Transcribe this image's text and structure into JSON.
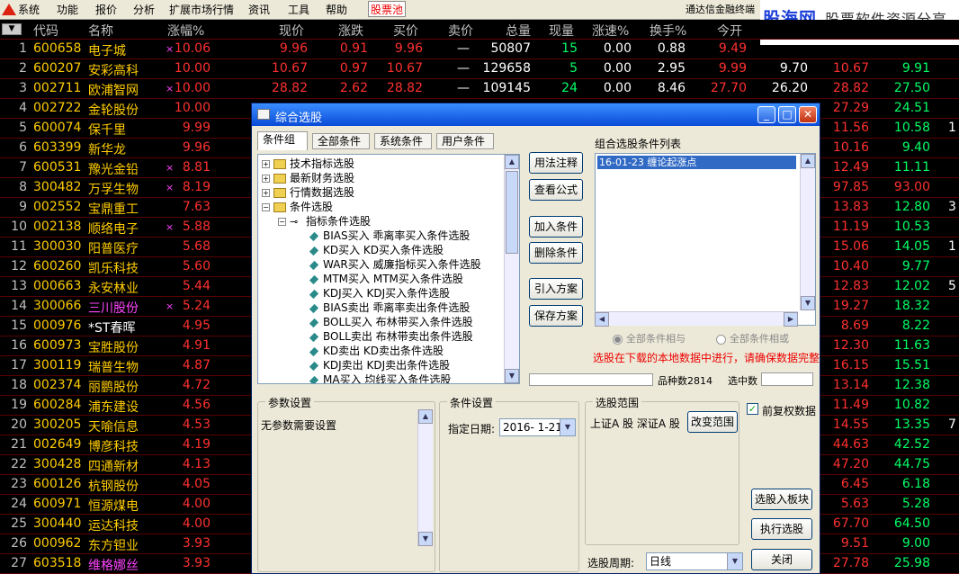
{
  "menu": [
    "系统",
    "功能",
    "报价",
    "分析",
    "扩展市场行情",
    "资讯",
    "工具",
    "帮助",
    "股票池"
  ],
  "broker": "通达信金融终端",
  "brand": {
    "name": "股海网",
    "slogan": "股票软件资源分享",
    "url": "Www.Guhai.com.cn"
  },
  "columns": [
    "代码",
    "名称",
    "涨幅%",
    "现价",
    "涨跌",
    "买价",
    "卖价",
    "总量",
    "现量",
    "涨速%",
    "换手%",
    "今开"
  ],
  "rows": [
    {
      "n": "1",
      "code": "600658",
      "name": "电子城",
      "mark": "×",
      "chg": "10.06",
      "price": "9.96",
      "rise": "0.91",
      "bid": "9.96",
      "ask": "—",
      "vol": "50807",
      "cur": "15",
      "spd": "0.00",
      "turn": "0.88",
      "open": "9.49",
      "prev": "",
      "high": "",
      "low": "",
      "ex": ""
    },
    {
      "n": "2",
      "code": "600207",
      "name": "安彩高科",
      "mark": "",
      "chg": "10.00",
      "price": "10.67",
      "rise": "0.97",
      "bid": "10.67",
      "ask": "—",
      "vol": "129658",
      "cur": "5",
      "spd": "0.00",
      "turn": "2.95",
      "open": "9.99",
      "prev": "9.70",
      "high": "10.67",
      "low": "9.91",
      "ex": ""
    },
    {
      "n": "3",
      "code": "002711",
      "name": "欧浦智网",
      "mark": "×",
      "chg": "10.00",
      "price": "28.82",
      "rise": "2.62",
      "bid": "28.82",
      "ask": "—",
      "vol": "109145",
      "cur": "24",
      "spd": "0.00",
      "turn": "8.46",
      "open": "27.70",
      "prev": "26.20",
      "high": "28.82",
      "low": "27.50",
      "ex": ""
    },
    {
      "n": "4",
      "code": "002722",
      "name": "金轮股份",
      "mark": "",
      "chg": "10.00",
      "price": "",
      "rise": "",
      "bid": "",
      "ask": "",
      "vol": "",
      "cur": "",
      "spd": "",
      "turn": "",
      "open": "",
      "prev": "",
      "high": "27.29",
      "low": "24.51",
      "ex": ""
    },
    {
      "n": "5",
      "code": "600074",
      "name": "保千里",
      "mark": "",
      "chg": "9.99",
      "price": "",
      "rise": "",
      "bid": "",
      "ask": "",
      "vol": "",
      "cur": "",
      "spd": "",
      "turn": "",
      "open": "",
      "prev": "",
      "high": "11.56",
      "low": "10.58",
      "ex": "1"
    },
    {
      "n": "6",
      "code": "603399",
      "name": "新华龙",
      "mark": "",
      "chg": "9.96",
      "price": "",
      "rise": "",
      "bid": "",
      "ask": "",
      "vol": "",
      "cur": "",
      "spd": "",
      "turn": "",
      "open": "",
      "prev": "",
      "high": "10.16",
      "low": "9.40",
      "ex": ""
    },
    {
      "n": "7",
      "code": "600531",
      "name": "豫光金铅",
      "mark": "×",
      "chg": "8.81",
      "price": "",
      "rise": "",
      "bid": "",
      "ask": "",
      "vol": "",
      "cur": "",
      "spd": "",
      "turn": "",
      "open": "",
      "prev": "",
      "high": "12.49",
      "low": "11.11",
      "ex": ""
    },
    {
      "n": "8",
      "code": "300482",
      "name": "万孚生物",
      "mark": "×",
      "chg": "8.19",
      "price": "",
      "rise": "",
      "bid": "",
      "ask": "",
      "vol": "",
      "cur": "",
      "spd": "",
      "turn": "",
      "open": "",
      "prev": "",
      "high": "97.85",
      "low": "93.00",
      "lowRed": true,
      "ex": ""
    },
    {
      "n": "9",
      "code": "002552",
      "name": "宝鼎重工",
      "mark": "",
      "chg": "7.63",
      "price": "",
      "rise": "",
      "bid": "",
      "ask": "",
      "vol": "",
      "cur": "",
      "spd": "",
      "turn": "",
      "open": "",
      "prev": "",
      "high": "13.83",
      "low": "12.80",
      "ex": "3"
    },
    {
      "n": "10",
      "code": "002138",
      "name": "顺络电子",
      "mark": "×",
      "chg": "5.88",
      "price": "",
      "rise": "",
      "bid": "",
      "ask": "",
      "vol": "",
      "cur": "",
      "spd": "",
      "turn": "",
      "open": "",
      "prev": "",
      "high": "11.19",
      "low": "10.53",
      "ex": ""
    },
    {
      "n": "11",
      "code": "300030",
      "name": "阳普医疗",
      "mark": "",
      "chg": "5.68",
      "price": "",
      "rise": "",
      "bid": "",
      "ask": "",
      "vol": "",
      "cur": "",
      "spd": "",
      "turn": "",
      "open": "",
      "prev": "",
      "high": "15.06",
      "low": "14.05",
      "ex": "1"
    },
    {
      "n": "12",
      "code": "600260",
      "name": "凯乐科技",
      "mark": "",
      "chg": "5.60",
      "price": "",
      "rise": "",
      "bid": "",
      "ask": "",
      "vol": "",
      "cur": "",
      "spd": "",
      "turn": "",
      "open": "",
      "prev": "",
      "high": "10.40",
      "low": "9.77",
      "ex": ""
    },
    {
      "n": "13",
      "code": "000663",
      "name": "永安林业",
      "mark": "",
      "chg": "5.44",
      "price": "",
      "rise": "",
      "bid": "",
      "ask": "",
      "vol": "",
      "cur": "",
      "spd": "",
      "turn": "",
      "open": "",
      "prev": "",
      "high": "12.83",
      "low": "12.02",
      "ex": "5"
    },
    {
      "n": "14",
      "code": "300066",
      "name": "三川股份",
      "style": "p",
      "mark": "×",
      "chg": "5.24",
      "price": "",
      "rise": "",
      "bid": "",
      "ask": "",
      "vol": "",
      "cur": "",
      "spd": "",
      "turn": "",
      "open": "",
      "prev": "",
      "high": "19.27",
      "low": "18.32",
      "ex": ""
    },
    {
      "n": "15",
      "code": "000976",
      "name": "*ST春晖",
      "style": "w",
      "mark": "",
      "chg": "4.95",
      "price": "",
      "rise": "",
      "bid": "",
      "ask": "",
      "vol": "",
      "cur": "",
      "spd": "",
      "turn": "",
      "open": "",
      "prev": "",
      "high": "8.69",
      "low": "8.22",
      "ex": ""
    },
    {
      "n": "16",
      "code": "600973",
      "name": "宝胜股份",
      "mark": "",
      "chg": "4.91",
      "price": "",
      "rise": "",
      "bid": "",
      "ask": "",
      "vol": "",
      "cur": "",
      "spd": "",
      "turn": "",
      "open": "",
      "prev": "",
      "high": "12.30",
      "low": "11.63",
      "ex": ""
    },
    {
      "n": "17",
      "code": "300119",
      "name": "瑞普生物",
      "mark": "",
      "chg": "4.87",
      "price": "",
      "rise": "",
      "bid": "",
      "ask": "",
      "vol": "",
      "cur": "",
      "spd": "",
      "turn": "",
      "open": "",
      "prev": "",
      "high": "16.15",
      "low": "15.51",
      "ex": ""
    },
    {
      "n": "18",
      "code": "002374",
      "name": "丽鹏股份",
      "mark": "",
      "chg": "4.72",
      "price": "",
      "rise": "",
      "bid": "",
      "ask": "",
      "vol": "",
      "cur": "",
      "spd": "",
      "turn": "",
      "open": "",
      "prev": "",
      "high": "13.14",
      "low": "12.38",
      "ex": ""
    },
    {
      "n": "19",
      "code": "600284",
      "name": "浦东建设",
      "mark": "",
      "chg": "4.56",
      "price": "",
      "rise": "",
      "bid": "",
      "ask": "",
      "vol": "",
      "cur": "",
      "spd": "",
      "turn": "",
      "open": "",
      "prev": "",
      "high": "11.49",
      "low": "10.82",
      "ex": ""
    },
    {
      "n": "20",
      "code": "300205",
      "name": "天喻信息",
      "mark": "",
      "chg": "4.53",
      "price": "",
      "rise": "",
      "bid": "",
      "ask": "",
      "vol": "",
      "cur": "",
      "spd": "",
      "turn": "",
      "open": "",
      "prev": "",
      "high": "14.55",
      "low": "13.35",
      "ex": "7"
    },
    {
      "n": "21",
      "code": "002649",
      "name": "博彦科技",
      "mark": "",
      "chg": "4.19",
      "price": "",
      "rise": "",
      "bid": "",
      "ask": "",
      "vol": "",
      "cur": "",
      "spd": "",
      "turn": "",
      "open": "",
      "prev": "",
      "high": "44.63",
      "low": "42.52",
      "ex": ""
    },
    {
      "n": "22",
      "code": "300428",
      "name": "四通新材",
      "mark": "",
      "chg": "4.13",
      "price": "",
      "rise": "",
      "bid": "",
      "ask": "",
      "vol": "",
      "cur": "",
      "spd": "",
      "turn": "",
      "open": "",
      "prev": "",
      "high": "47.20",
      "low": "44.75",
      "ex": ""
    },
    {
      "n": "23",
      "code": "600126",
      "name": "杭钢股份",
      "mark": "",
      "chg": "4.05",
      "price": "",
      "rise": "",
      "bid": "",
      "ask": "",
      "vol": "",
      "cur": "",
      "spd": "",
      "turn": "",
      "open": "",
      "prev": "",
      "high": "6.45",
      "low": "6.18",
      "ex": ""
    },
    {
      "n": "24",
      "code": "600971",
      "name": "恒源煤电",
      "mark": "",
      "chg": "4.00",
      "price": "",
      "rise": "",
      "bid": "",
      "ask": "",
      "vol": "",
      "cur": "",
      "spd": "",
      "turn": "",
      "open": "",
      "prev": "",
      "high": "5.63",
      "low": "5.28",
      "ex": ""
    },
    {
      "n": "25",
      "code": "300440",
      "name": "运达科技",
      "mark": "",
      "chg": "4.00",
      "price": "",
      "rise": "",
      "bid": "",
      "ask": "",
      "vol": "",
      "cur": "",
      "spd": "",
      "turn": "",
      "open": "",
      "prev": "",
      "high": "67.70",
      "low": "64.50",
      "ex": ""
    },
    {
      "n": "26",
      "code": "000962",
      "name": "东方钽业",
      "mark": "",
      "chg": "3.93",
      "price": "",
      "rise": "",
      "bid": "",
      "ask": "",
      "vol": "",
      "cur": "",
      "spd": "",
      "turn": "",
      "open": "",
      "prev": "",
      "high": "9.51",
      "low": "9.00",
      "ex": ""
    },
    {
      "n": "27",
      "code": "603518",
      "name": "维格娜丝",
      "style": "p",
      "mark": "",
      "chg": "3.93",
      "price": "",
      "rise": "",
      "bid": "",
      "ask": "",
      "vol": "",
      "cur": "",
      "spd": "",
      "turn": "",
      "open": "",
      "prev": "",
      "high": "27.78",
      "low": "25.98",
      "ex": ""
    }
  ],
  "dialog": {
    "title": "综合选股",
    "tabs": [
      "条件组",
      "全部条件",
      "系统条件",
      "用户条件"
    ],
    "tree": [
      {
        "label": "技术指标选股",
        "type": "folder",
        "exp": "+"
      },
      {
        "label": "最新财务选股",
        "type": "folder",
        "exp": "+"
      },
      {
        "label": "行情数据选股",
        "type": "folder",
        "exp": "+"
      },
      {
        "label": "条件选股",
        "type": "folder",
        "exp": "−"
      },
      {
        "label": "指标条件选股",
        "type": "key",
        "exp": "−"
      },
      {
        "label": "BIAS买入 乖离率买入条件选股",
        "type": "leaf"
      },
      {
        "label": "KD买入 KD买入条件选股",
        "type": "leaf"
      },
      {
        "label": "WAR买入 威廉指标买入条件选股",
        "type": "leaf"
      },
      {
        "label": "MTM买入 MTM买入条件选股",
        "type": "leaf"
      },
      {
        "label": "KDJ买入 KDJ买入条件选股",
        "type": "leaf"
      },
      {
        "label": "BIAS卖出 乖离率卖出条件选股",
        "type": "leaf"
      },
      {
        "label": "BOLL买入 布林带买入条件选股",
        "type": "leaf"
      },
      {
        "label": "BOLL卖出 布林带卖出条件选股",
        "type": "leaf"
      },
      {
        "label": "KD卖出 KD卖出条件选股",
        "type": "leaf"
      },
      {
        "label": "KDJ卖出 KDJ卖出条件选股",
        "type": "leaf"
      },
      {
        "label": "MA买入 均线买入条件选股",
        "type": "leaf"
      }
    ],
    "buttons": {
      "usage": "用法注释",
      "view": "查看公式",
      "add": "加入条件",
      "del": "删除条件",
      "import": "引入方案",
      "save": "保存方案"
    },
    "list_label": "组合选股条件列表",
    "list_items": [
      "16-01-23 缠论起涨点"
    ],
    "radio_and": "全部条件相与",
    "radio_or": "全部条件相或",
    "warning": "选股在下载的本地数据中进行，请确保数据完整",
    "count_label": "品种数",
    "count_value": "2814",
    "selected_label": "选中数",
    "param_title": "参数设置",
    "param_text": "无参数需要设置",
    "cond_title": "条件设置",
    "date_label": "指定日期:",
    "date_value": "2016- 1-21",
    "range_title": "选股范围",
    "range_text": "上证A 股  深证A 股",
    "range_btn": "改变范围",
    "rehab": "前复权数据",
    "to_board": "选股入板块",
    "execute": "执行选股",
    "close": "关闭",
    "period_label": "选股周期:",
    "period_value": "日线"
  }
}
